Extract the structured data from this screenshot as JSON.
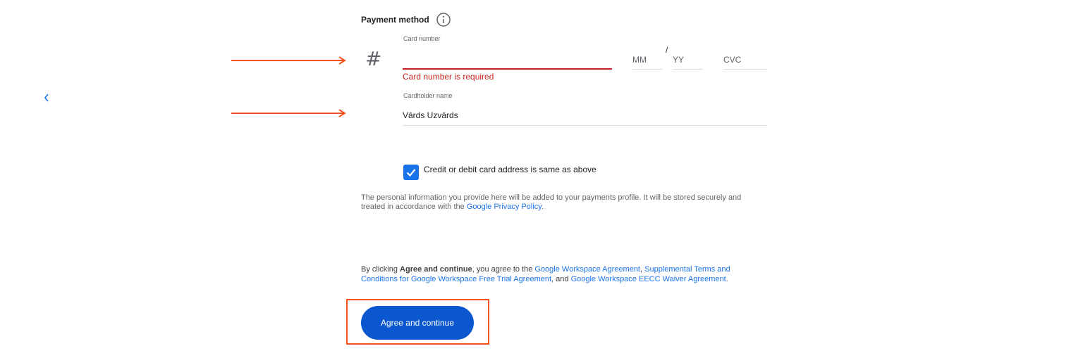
{
  "nav": {
    "back_icon": "chevron-left-icon"
  },
  "payment": {
    "title": "Payment method",
    "info_icon": "info-icon",
    "card_icon": "#",
    "card_number": {
      "label": "Card number",
      "value": "",
      "error": "Card number is required"
    },
    "expiry": {
      "month_placeholder": "MM",
      "separator": "/",
      "year_placeholder": "YY"
    },
    "cvc_placeholder": "CVC",
    "cardholder": {
      "label": "Cardholder name",
      "value": "Vārds Uzvārds"
    },
    "same_address": {
      "checked": true,
      "label": "Credit or debit card address is same as above"
    },
    "privacy": {
      "text_before": "The personal information you provide here will be added to your payments profile. It will be stored securely and treated in accordance with the ",
      "link": "Google Privacy Policy",
      "text_after": "."
    }
  },
  "terms": {
    "prefix": "By clicking ",
    "bold": "Agree and continue",
    "mid": ", you agree to the ",
    "link1": "Google Workspace Agreement",
    "sep1": ", ",
    "link2": "Supplemental Terms and Conditions for Google Workspace Free Trial Agreement",
    "sep2": ", and ",
    "link3": "Google Workspace EECC Waiver Agreement",
    "end": "."
  },
  "actions": {
    "agree_label": "Agree and continue"
  },
  "colors": {
    "accent": "#1a73e8",
    "button": "#0b57d0",
    "error": "#c5221f",
    "annotation": "#f4511e"
  }
}
